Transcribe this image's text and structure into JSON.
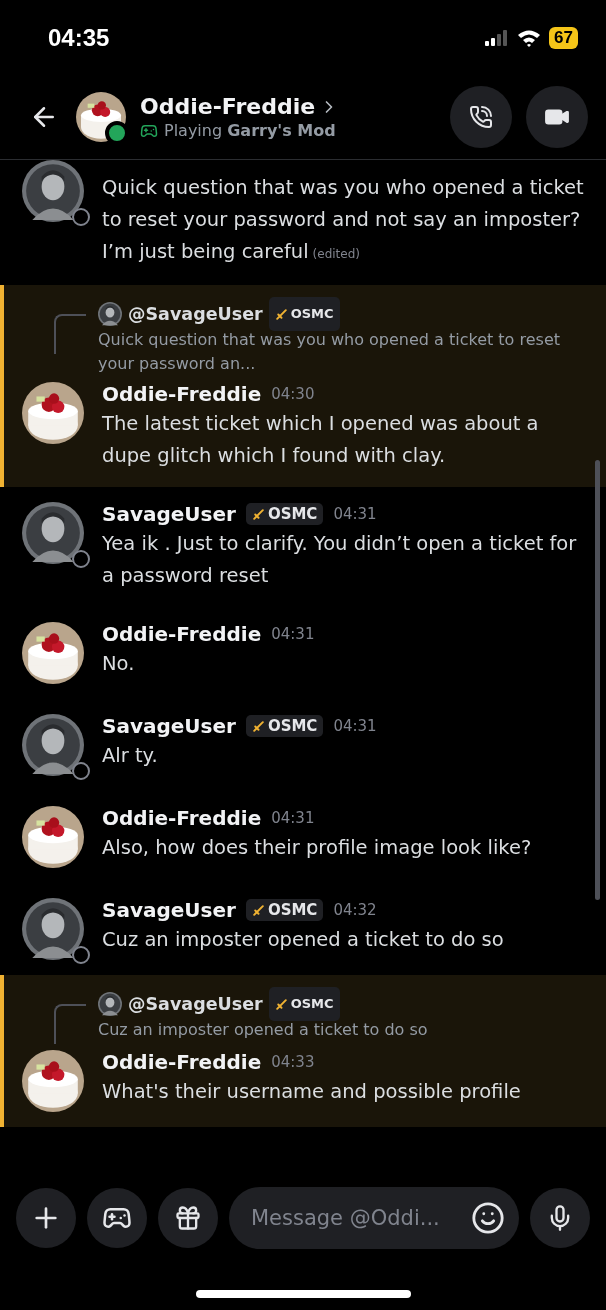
{
  "status_bar": {
    "time": "04:35",
    "battery": "67"
  },
  "header": {
    "name": "Oddie-Freddie",
    "online": true,
    "activity": "Playing **Garry's Mod**"
  },
  "messages": [
    {
      "avatar": {
        "kind": "man",
        "offline": true
      },
      "highlighted": false,
      "text": "Quick question that was you who opened a ticket to reset your password and not say an imposter? I’m just being careful",
      "edited": "(edited)"
    },
    {
      "avatar": {
        "kind": "cake",
        "offline": false
      },
      "highlighted": true,
      "reply": {
        "author": "@SavageUser",
        "tag": "OSMC",
        "text": "Quick question that was you who opened a ticket to reset your password an..."
      },
      "author": "Oddie-Freddie",
      "time": "04:30",
      "text": "The latest ticket which I opened was about a dupe glitch which I found with clay."
    },
    {
      "avatar": {
        "kind": "man",
        "offline": true
      },
      "highlighted": false,
      "author": "SavageUser",
      "tag": "OSMC",
      "time": "04:31",
      "text": "Yea ik . Just to clarify. You didn’t open a ticket for a password reset"
    },
    {
      "avatar": {
        "kind": "cake",
        "offline": false
      },
      "highlighted": false,
      "author": "Oddie-Freddie",
      "time": "04:31",
      "text": "No."
    },
    {
      "avatar": {
        "kind": "man",
        "offline": true
      },
      "highlighted": false,
      "author": "SavageUser",
      "tag": "OSMC",
      "time": "04:31",
      "text": "Alr ty."
    },
    {
      "avatar": {
        "kind": "cake",
        "offline": false
      },
      "highlighted": false,
      "author": "Oddie-Freddie",
      "time": "04:31",
      "text": "Also, how does their profile image look like?"
    },
    {
      "avatar": {
        "kind": "man",
        "offline": true
      },
      "highlighted": false,
      "author": "SavageUser",
      "tag": "OSMC",
      "time": "04:32",
      "text": "Cuz an imposter opened a ticket to do so"
    },
    {
      "avatar": {
        "kind": "cake",
        "offline": false
      },
      "highlighted": true,
      "reply": {
        "author": "@SavageUser",
        "tag": "OSMC",
        "text": "Cuz an imposter opened a ticket to do so"
      },
      "author": "Oddie-Freddie",
      "time": "04:33",
      "text": "What's their username and possible profile"
    }
  ],
  "composer": {
    "placeholder": "Message @Oddi..."
  }
}
